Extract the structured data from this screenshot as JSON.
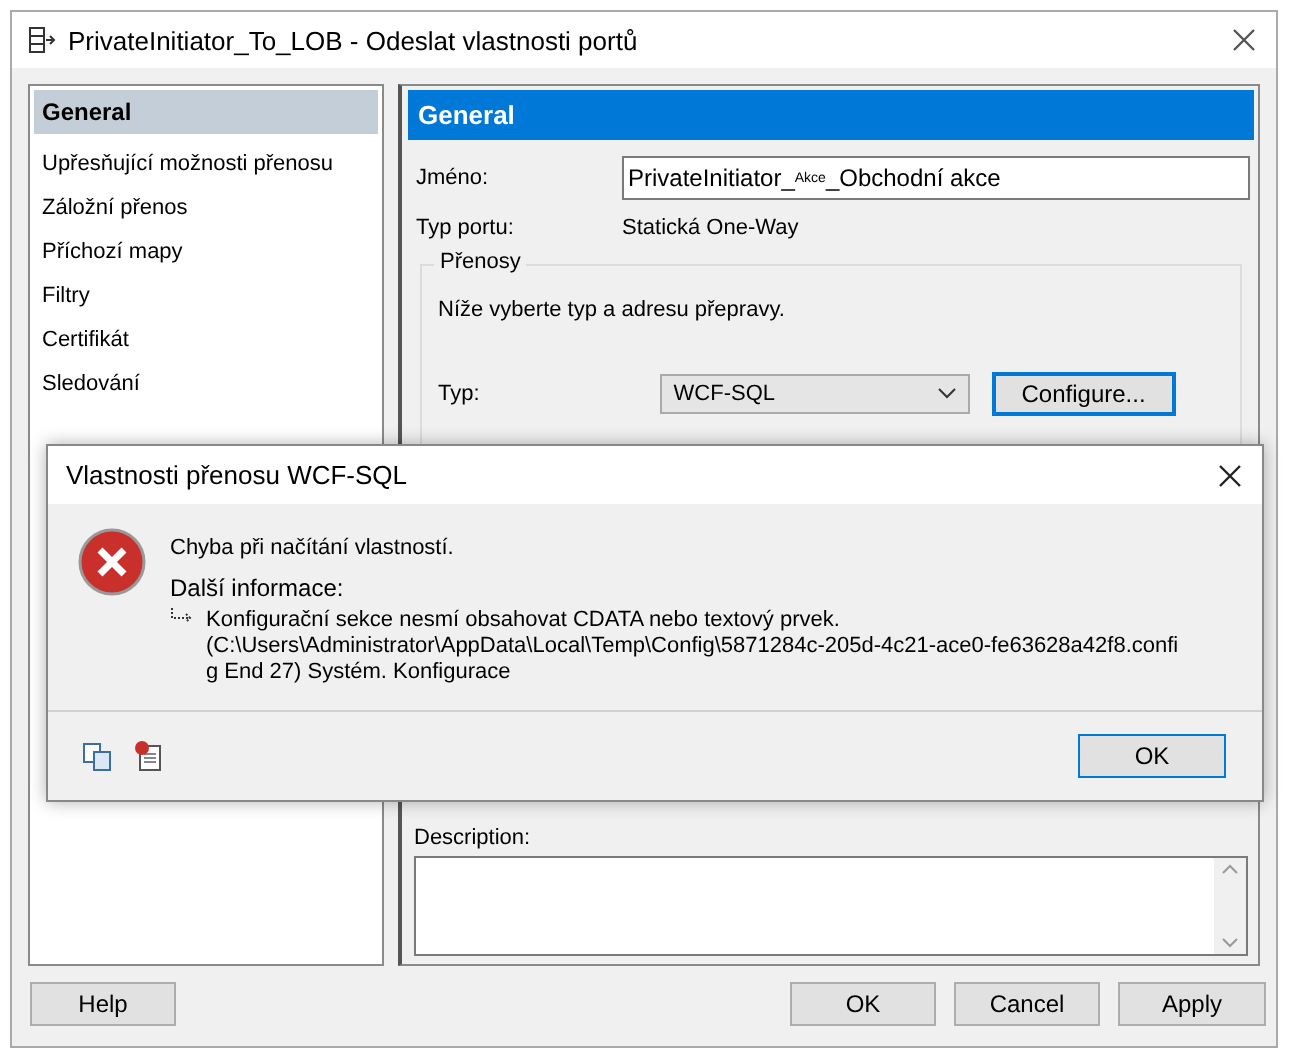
{
  "window": {
    "title": "PrivateInitiator_To_LOB - Odeslat vlastnosti portů"
  },
  "sidebar": {
    "items": [
      {
        "label": "General",
        "selected": true
      },
      {
        "label": "Upřesňující možnosti přenosu",
        "selected": false
      },
      {
        "label": "Záložní přenos",
        "selected": false
      },
      {
        "label": "Příchozí mapy",
        "selected": false
      },
      {
        "label": "Filtry",
        "selected": false
      },
      {
        "label": "Certifikát",
        "selected": false
      },
      {
        "label": "Sledování",
        "selected": false
      }
    ]
  },
  "panel": {
    "header": "General",
    "name_label": "Jméno:",
    "name_value": "PrivateInitiator_$^{Akce}$_Obchodní akce",
    "port_type_label": "Typ portu:",
    "port_type_value": "Statická One-Way",
    "transports": {
      "legend": "Přenosy",
      "hint": "Níže vyberte typ a adresu přepravy.",
      "type_label": "Typ:",
      "type_value": "WCF-SQL",
      "configure_button": "Configure..."
    },
    "description_label": "Description:"
  },
  "buttons": {
    "help": "Help",
    "ok": "OK",
    "cancel": "Cancel",
    "apply": "Apply"
  },
  "dialog": {
    "title": "Vlastnosti přenosu WCF-SQL",
    "message": "Chyba při načítání vlastností.",
    "details_label": "Další informace:",
    "details_lines": [
      "Konfigurační sekce nesmí obsahovat CDATA nebo textový prvek.",
      "(C:\\Users\\Administrator\\AppData\\Local\\Temp\\Config\\5871284c-205d-4c21-ace0-fe63628a42f8.confi",
      "g End 27) Systém. Konfigurace"
    ],
    "ok_button": "OK"
  }
}
